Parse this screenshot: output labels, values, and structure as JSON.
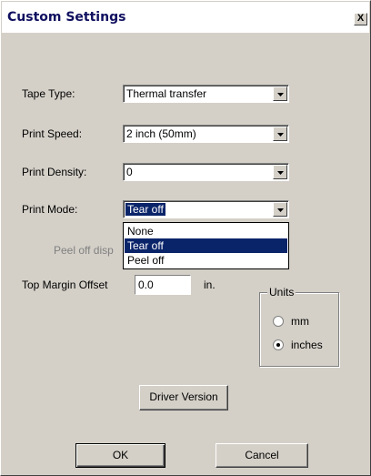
{
  "window": {
    "title": "Custom Settings",
    "close_glyph": "X"
  },
  "tape_type": {
    "label": "Tape Type:",
    "value": "Thermal transfer"
  },
  "print_speed": {
    "label": "Print Speed:",
    "value": "2 inch (50mm)"
  },
  "print_density": {
    "label": "Print Density:",
    "value": "0"
  },
  "print_mode": {
    "label": "Print Mode:",
    "value": "Tear off",
    "options": [
      "None",
      "Tear off",
      "Peel off"
    ],
    "highlighted_option": "Tear off"
  },
  "peel_off_label": "Peel off disp",
  "top_margin": {
    "label": "Top Margin Offset",
    "value": "0.0",
    "unit": "in."
  },
  "units": {
    "legend": "Units",
    "mm_label": "mm",
    "inches_label": "inches",
    "selected": "inches"
  },
  "buttons": {
    "driver_version": "Driver Version",
    "ok": "OK",
    "cancel": "Cancel"
  },
  "icons": {
    "dropdown": "chevron-down-icon",
    "close": "close-icon"
  },
  "colors": {
    "selection": "#0a246a",
    "dialog_bg": "#d4d0c8"
  }
}
